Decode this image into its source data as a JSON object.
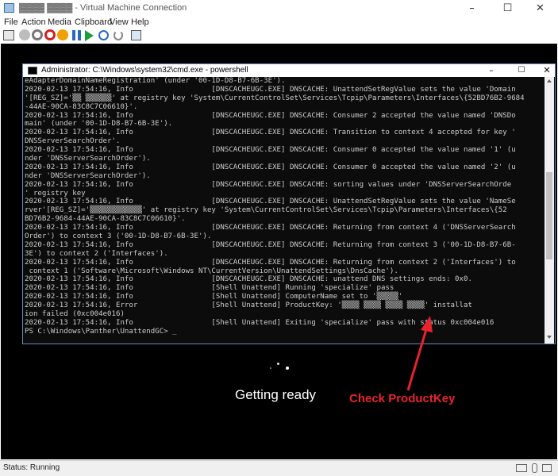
{
  "window": {
    "title": "▓▓▓▓ ▓▓▓▓ - Virtual Machine Connection",
    "minimize": "–",
    "maximize": "☐",
    "close": "✕"
  },
  "menu": [
    "File",
    "Action",
    "Media",
    "Clipboard",
    "View",
    "Help"
  ],
  "cmd": {
    "title": "Administrator: C:\\Windows\\system32\\cmd.exe - powershell",
    "lines": [
      "eAdapterDomainNameRegistration' (under '00-1D-D8-B7-6B-3E').",
      "2020-02-13 17:54:16, Info                  [DNSCACHEUGC.EXE] DNSCACHE: UnattendSetRegValue sets the value 'Domain",
      "'[REG_SZ]='▒▒ ▒▒▒▒▒▒' at registry key 'System\\CurrentControlSet\\Services\\Tcpip\\Parameters\\Interfaces\\{52BD76B2-9684",
      "-44AE-90CA-83C8C7C06610}'.",
      "2020-02-13 17:54:16, Info                  [DNSCACHEUGC.EXE] DNSCACHE: Consumer 2 accepted the value named 'DNSDo",
      "main' (under '00-1D-D8-B7-6B-3E').",
      "2020-02-13 17:54:16, Info                  [DNSCACHEUGC.EXE] DNSCACHE: Transition to context 4 accepted for key '",
      "DNSServerSearchOrder'.",
      "2020-02-13 17:54:16, Info                  [DNSCACHEUGC.EXE] DNSCACHE: Consumer 0 accepted the value named '1' (u",
      "nder 'DNSServerSearchOrder').",
      "2020-02-13 17:54:16, Info                  [DNSCACHEUGC.EXE] DNSCACHE: Consumer 0 accepted the value named '2' (u",
      "nder 'DNSServerSearchOrder').",
      "2020-02-13 17:54:16, Info                  [DNSCACHEUGC.EXE] DNSCACHE: sorting values under 'DNSServerSearchOrde",
      "' registry key",
      "2020-02-13 17:54:16, Info                  [DNSCACHEUGC.EXE] DNSCACHE: UnattendSetRegValue sets the value 'NameSe",
      "rver'[REG_SZ]='▒▒▒▒▒▒▒▒▒▒▒▒' at registry key 'System\\CurrentControlSet\\Services\\Tcpip\\Parameters\\Interfaces\\{52",
      "BD76B2-9684-44AE-90CA-83C8C7C06610}'.",
      "2020-02-13 17:54:16, Info                  [DNSCACHEUGC.EXE] DNSCACHE: Returning from context 4 ('DNSServerSearch",
      "Order') to context 3 ('00-1D-D8-B7-6B-3E').",
      "2020-02-13 17:54:16, Info                  [DNSCACHEUGC.EXE] DNSCACHE: Returning from context 3 ('00-1D-D8-B7-6B-",
      "3E') to context 2 ('Interfaces').",
      "2020-02-13 17:54:16, Info                  [DNSCACHEUGC.EXE] DNSCACHE: Returning from context 2 ('Interfaces') to",
      " context 1 ('Software\\Microsoft\\Windows NT\\CurrentVersion\\UnattendSettings\\DnsCache').",
      "2020-02-13 17:54:16, Info                  [DNSCACHEUGC.EXE] DNSCACHE: unattend DNS settings ends: 0x0.",
      "2020-02-13 17:54:16, Info                  [Shell Unattend] Running 'specialize' pass",
      "2020-02-13 17:54:16, Info                  [Shell Unattend] ComputerName set to '▒▒▒▒▒'",
      "2020-02-13 17:54:16, Error                 [Shell Unattend] ProductKey: '▒▒▒▒ ▒▒▒▒ ▒▒▒▒ ▒▒▒▒' installat",
      "ion failed (0xc004e016)",
      "2020-02-13 17:54:16, Info                  [Shell Unattend] Exiting 'specialize' pass with status 0xc004e016",
      "PS C:\\Windows\\Panther\\UnattendGC> _"
    ]
  },
  "vm": {
    "getting_ready": "Getting ready"
  },
  "annotation": {
    "text": "Check ProductKey",
    "color": "#e8232d"
  },
  "status": {
    "text": "Status: Running"
  }
}
